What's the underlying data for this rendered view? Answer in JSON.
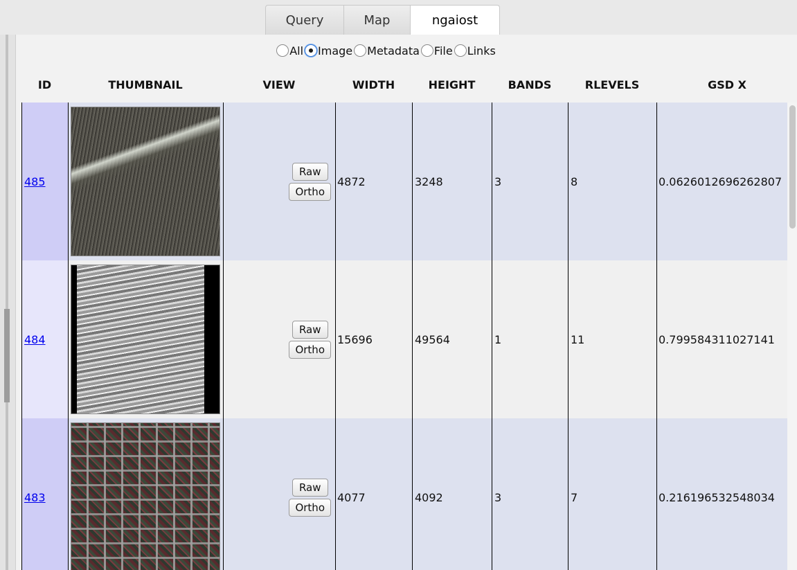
{
  "tabs": [
    {
      "label": "Query"
    },
    {
      "label": "Map"
    },
    {
      "label": "ngaiost"
    }
  ],
  "view_options": {
    "all": "All",
    "image": "Image",
    "metadata": "Metadata",
    "file": "File",
    "links": "Links",
    "selected": "Image"
  },
  "table": {
    "columns": [
      "ID",
      "THUMBNAIL",
      "VIEW",
      "WIDTH",
      "HEIGHT",
      "BANDS",
      "RLEVELS",
      "GSD X"
    ],
    "raw_label": "Raw",
    "ortho_label": "Ortho",
    "rows": [
      {
        "id": "485",
        "width": "4872",
        "height": "3248",
        "bands": "3",
        "rlevels": "8",
        "gsd_x": "0.0626012696262807"
      },
      {
        "id": "484",
        "width": "15696",
        "height": "49564",
        "bands": "1",
        "rlevels": "11",
        "gsd_x": "0.799584311027141"
      },
      {
        "id": "483",
        "width": "4077",
        "height": "4092",
        "bands": "3",
        "rlevels": "7",
        "gsd_x": "0.216196532548034"
      }
    ]
  }
}
